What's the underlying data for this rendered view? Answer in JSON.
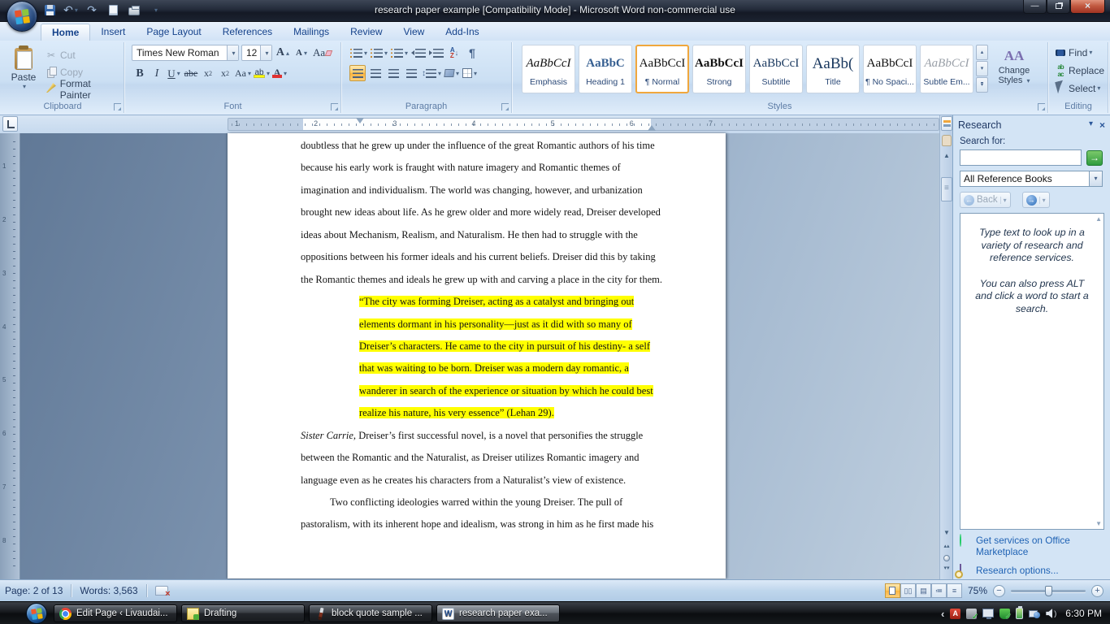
{
  "titlebar": {
    "title": "research paper example [Compatibility Mode] - Microsoft Word non-commercial use"
  },
  "icons": {
    "caret": "▾",
    "up_caret": "▴",
    "double_up": "▴▴",
    "double_down": "▾▾",
    "scroll_up": "▲",
    "scroll_down": "▼",
    "undo": "↶",
    "redo": "↷",
    "go_arrow": "→",
    "back_arrow": "←",
    "fwd_arrow": "→",
    "close": "×",
    "minimize": "—",
    "pilcrow": "¶",
    "updown": "↕",
    "sort_arrow": "↓",
    "chevron_left": "‹",
    "speaker_waves": ")"
  },
  "colors": {
    "highlight_yellow": "#ffff00",
    "selection_orange": "#fbb33e",
    "accent_blue": "#15428b",
    "font_color_red": "#e03131"
  },
  "tabs": {
    "items": [
      {
        "label": "Home",
        "active": true
      },
      {
        "label": "Insert"
      },
      {
        "label": "Page Layout"
      },
      {
        "label": "References"
      },
      {
        "label": "Mailings"
      },
      {
        "label": "Review"
      },
      {
        "label": "View"
      },
      {
        "label": "Add-Ins"
      }
    ]
  },
  "ribbon": {
    "clipboard": {
      "group_label": "Clipboard",
      "paste": "Paste",
      "cut": "Cut",
      "copy": "Copy",
      "format_painter": "Format Painter"
    },
    "font": {
      "group_label": "Font",
      "family": "Times New Roman",
      "size": "12",
      "bold": "B",
      "italic": "I",
      "underline": "U",
      "strike": "abe",
      "sub_base": "x",
      "sub_small": "2",
      "sup_base": "x",
      "sup_small": "2",
      "case": "Aa",
      "grow": "A",
      "shrink": "A",
      "clear": "Aa",
      "highlight_ab": "ab",
      "fontcolor_a": "A"
    },
    "paragraph": {
      "group_label": "Paragraph",
      "sort_a": "A",
      "sort_z": "Z"
    },
    "styles": {
      "group_label": "Styles",
      "change_styles_line1": "Change",
      "change_styles_line2": "Styles",
      "change_icon_a1": "A",
      "change_icon_a2": "A",
      "items": [
        {
          "preview": "AaBbCcI",
          "label": "Emphasis",
          "kind": "emphasis"
        },
        {
          "preview": "AaBbC",
          "label": "Heading 1",
          "kind": "heading1"
        },
        {
          "preview": "AaBbCcI",
          "label": "¶ Normal",
          "kind": "normal",
          "selected": true
        },
        {
          "preview": "AaBbCcI",
          "label": "Strong",
          "kind": "strong"
        },
        {
          "preview": "AaBbCcI",
          "label": "Subtitle",
          "kind": "subtitle"
        },
        {
          "preview": "AaBb(",
          "label": "Title",
          "kind": "title"
        },
        {
          "preview": "AaBbCcI",
          "label": "¶ No Spaci...",
          "kind": "nospacing"
        },
        {
          "preview": "AaBbCcI",
          "label": "Subtle Em...",
          "kind": "subtle"
        }
      ]
    },
    "editing": {
      "group_label": "Editing",
      "find": "Find",
      "replace": "Replace",
      "select": "Select"
    }
  },
  "ruler": {
    "h_numbers": [
      "1",
      "2",
      "3",
      "4",
      "5",
      "6",
      "7"
    ],
    "v_numbers": [
      "1",
      "2",
      "3",
      "4",
      "5",
      "6",
      "7",
      "8"
    ],
    "tab_selector": "L"
  },
  "document": {
    "lines": [
      {
        "text": "doubtless that he grew up under the influence of the great Romantic authors of his time"
      },
      {
        "text": "because his early work is fraught with nature imagery and Romantic themes of"
      },
      {
        "text": "imagination and individualism.  The world was changing, however, and urbanization"
      },
      {
        "text": "brought new ideas about life.  As he grew older and more widely read, Dreiser developed"
      },
      {
        "text": "ideas about Mechanism, Realism, and Naturalism.  He then had to struggle with the"
      },
      {
        "text": "oppositions between his former ideals and his current beliefs.  Dreiser did this by taking"
      },
      {
        "text": "the Romantic themes and ideals he grew up with and carving a place in the city for them."
      },
      {
        "text": "“The city was forming Dreiser, acting as a catalyst and bringing out",
        "quote": true
      },
      {
        "text": "elements dormant in his personality—just as it did with so many of",
        "quote": true
      },
      {
        "text": "Dreiser’s characters.  He came to the city in pursuit of his destiny- a self",
        "quote": true
      },
      {
        "text": "that was waiting to be born.  Dreiser was a modern day romantic, a",
        "quote": true
      },
      {
        "text": "wanderer in search of the experience or situation by which he could best",
        "quote": true
      },
      {
        "text": "realize his nature, his very essence” (Lehan 29).",
        "quote": true
      },
      {
        "lead_italic": "Sister Carrie,",
        "text": " Dreiser’s first successful novel, is a novel that personifies the struggle"
      },
      {
        "text": "between the Romantic and the Naturalist, as Dreiser utilizes Romantic imagery and"
      },
      {
        "text": "language even as he creates his characters from a Naturalist’s view of existence."
      },
      {
        "text": "Two conflicting ideologies warred within the young Dreiser.  The pull of",
        "indent": true
      },
      {
        "text": "pastoralism, with its inherent hope and idealism, was strong in him as he first made his"
      }
    ]
  },
  "research": {
    "title": "Research",
    "search_label": "Search for:",
    "search_value": "",
    "source": "All Reference Books",
    "back_label": "Back",
    "hint1": "Type text to look up in a variety of research and reference services.",
    "hint2": "You can also press ALT and click a word to start a search.",
    "link_marketplace": "Get services on Office Marketplace",
    "link_options": "Research options..."
  },
  "statusbar": {
    "page": "Page: 2 of 13",
    "words": "Words: 3,563",
    "zoom": "75%"
  },
  "taskbar": {
    "buttons": [
      {
        "label": "Edit Page ‹ Livaudai...",
        "icon": "chrome"
      },
      {
        "label": "Drafting",
        "icon": "notepad"
      },
      {
        "label": "block quote sample ...",
        "icon": "paintbrush"
      },
      {
        "label": "research paper exa...",
        "icon": "word",
        "active": true
      }
    ],
    "time": "6:30 PM"
  }
}
